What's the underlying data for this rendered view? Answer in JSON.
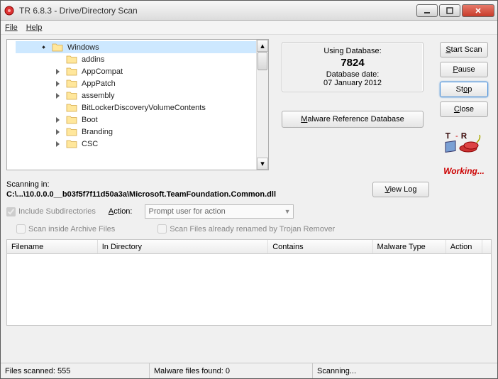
{
  "window": {
    "title": "TR 6.8.3  -  Drive/Directory Scan"
  },
  "menu": {
    "file": "File",
    "help": "Help"
  },
  "tree": {
    "items": [
      {
        "label": "Windows",
        "depth": 0,
        "expanded": true
      },
      {
        "label": "addins",
        "depth": 1,
        "expanded": false,
        "hasChildren": false
      },
      {
        "label": "AppCompat",
        "depth": 1,
        "expanded": false,
        "hasChildren": true
      },
      {
        "label": "AppPatch",
        "depth": 1,
        "expanded": false,
        "hasChildren": true
      },
      {
        "label": "assembly",
        "depth": 1,
        "expanded": false,
        "hasChildren": true
      },
      {
        "label": "BitLockerDiscoveryVolumeContents",
        "depth": 1,
        "expanded": false,
        "hasChildren": false
      },
      {
        "label": "Boot",
        "depth": 1,
        "expanded": false,
        "hasChildren": true
      },
      {
        "label": "Branding",
        "depth": 1,
        "expanded": false,
        "hasChildren": true
      },
      {
        "label": "CSC",
        "depth": 1,
        "expanded": false,
        "hasChildren": true
      }
    ]
  },
  "database": {
    "using_label": "Using Database:",
    "count": "7824",
    "date_label": "Database date:",
    "date": "07 January 2012"
  },
  "ref_button": "Malware Reference Database",
  "buttons": {
    "start": "Start Scan",
    "pause": "Pause",
    "stop": "Stop",
    "close": "Close",
    "view_log": "View Log"
  },
  "working": "Working...",
  "scanning": {
    "label": "Scanning in:",
    "path": "C:\\...\\10.0.0.0__b03f5f7f11d50a3a\\Microsoft.TeamFoundation.Common.dll"
  },
  "options": {
    "include_sub": "Include Subdirectories",
    "include_sub_checked": true,
    "action_label": "Action:",
    "action_value": "Prompt user for action",
    "scan_archive": "Scan inside Archive Files",
    "scan_archive_checked": false,
    "scan_renamed": "Scan Files already renamed by Trojan Remover",
    "scan_renamed_checked": false
  },
  "table": {
    "headers": [
      "Filename",
      "In Directory",
      "Contains",
      "Malware Type",
      "Action"
    ]
  },
  "status": {
    "scanned": "Files scanned: 555",
    "found": "Malware files found: 0",
    "state": "Scanning..."
  }
}
